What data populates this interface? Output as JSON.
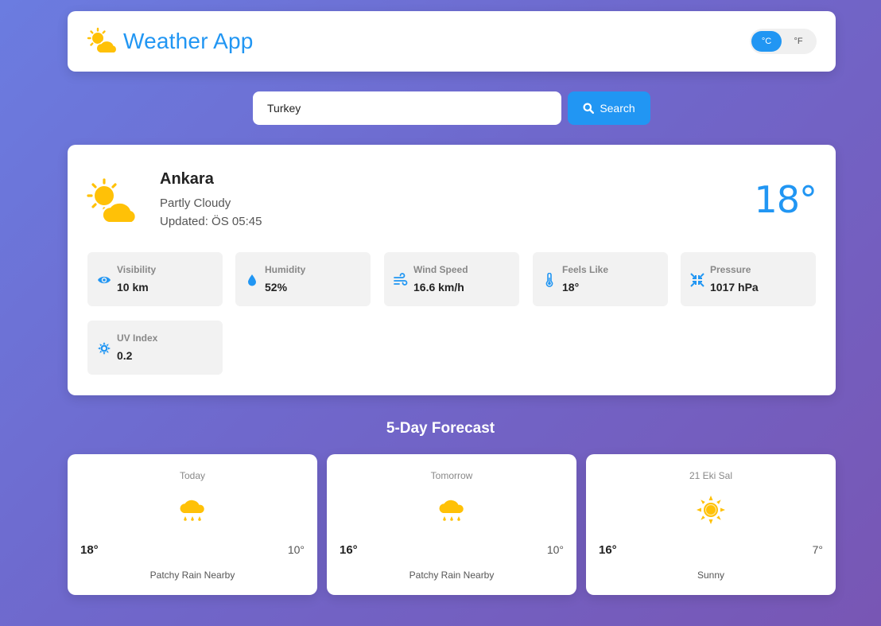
{
  "header": {
    "title": "Weather App",
    "logo_icon": "partly-cloudy-icon"
  },
  "units": {
    "celsius_label": "°C",
    "fahrenheit_label": "°F",
    "selected": "celsius"
  },
  "search": {
    "value": "Turkey",
    "placeholder": "",
    "button_label": "Search"
  },
  "current": {
    "city": "Ankara",
    "condition": "Partly Cloudy",
    "updated": "Updated: ÖS 05:45",
    "temperature": "18°",
    "icon": "partly-cloudy-icon",
    "details": [
      {
        "label": "Visibility",
        "value": "10 km",
        "icon": "eye-icon"
      },
      {
        "label": "Humidity",
        "value": "52%",
        "icon": "droplet-icon"
      },
      {
        "label": "Wind Speed",
        "value": "16.6 km/h",
        "icon": "wind-icon"
      },
      {
        "label": "Feels Like",
        "value": "18°",
        "icon": "thermometer-icon"
      },
      {
        "label": "Pressure",
        "value": "1017 hPa",
        "icon": "compress-icon"
      },
      {
        "label": "UV Index",
        "value": "0.2",
        "icon": "sun-gear-icon"
      }
    ]
  },
  "forecast": {
    "title": "5-Day Forecast",
    "days": [
      {
        "day": "Today",
        "high": "18°",
        "low": "10°",
        "description": "Patchy Rain Nearby",
        "icon": "rain-cloud-icon"
      },
      {
        "day": "Tomorrow",
        "high": "16°",
        "low": "10°",
        "description": "Patchy Rain Nearby",
        "icon": "rain-cloud-icon"
      },
      {
        "day": "21 Eki Sal",
        "high": "16°",
        "low": "7°",
        "description": "Sunny",
        "icon": "sun-icon"
      }
    ]
  },
  "colors": {
    "accent": "#2196f3",
    "icon_yellow": "#ffc107",
    "card_bg": "#ffffff",
    "detail_bg": "#f2f2f2"
  }
}
